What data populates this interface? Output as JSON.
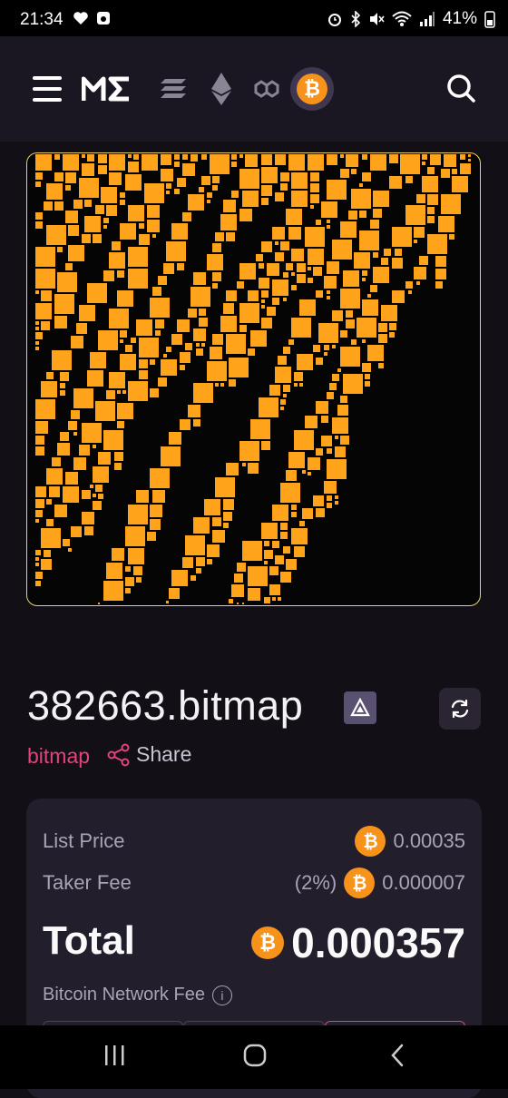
{
  "status_bar": {
    "time": "21:34",
    "battery": "41%"
  },
  "nav": {
    "icons": [
      "menu-icon",
      "magic-eden-logo",
      "solana-icon",
      "ethereum-icon",
      "polygon-icon",
      "bitcoin-icon",
      "search-icon"
    ],
    "active_chain": "bitcoin"
  },
  "item": {
    "title": "382663.bitmap",
    "collection": "bitmap",
    "share_label": "Share"
  },
  "pricing": {
    "list_price_label": "List Price",
    "list_price_value": "0.00035",
    "taker_fee_label": "Taker Fee",
    "taker_fee_percent": "(2%)",
    "taker_fee_value": "0.000007",
    "total_label": "Total",
    "total_value": "0.000357",
    "network_fee_label": "Bitcoin Network Fee"
  },
  "colors": {
    "accent": "#e2447a",
    "bitcoin": "#f7931a",
    "bitmap_block": "#ffa31a"
  }
}
